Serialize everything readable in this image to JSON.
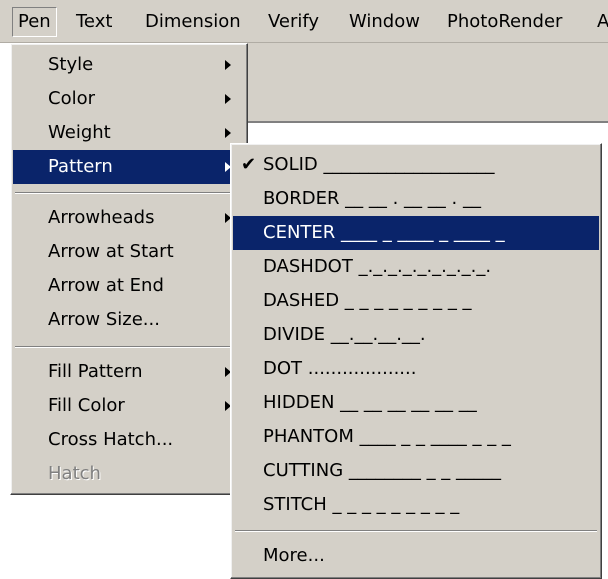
{
  "menubar": {
    "items": [
      "Pen",
      "Text",
      "Dimension",
      "Verify",
      "Window",
      "PhotoRender",
      "A"
    ]
  },
  "pen_menu": {
    "items": [
      {
        "label": "Style",
        "submenu": true
      },
      {
        "label": "Color",
        "submenu": true
      },
      {
        "label": "Weight",
        "submenu": true
      },
      {
        "label": "Pattern",
        "submenu": true,
        "highlighted": true
      },
      {
        "label": "Arrowheads",
        "submenu": true
      },
      {
        "label": "Arrow at Start"
      },
      {
        "label": "Arrow at End"
      },
      {
        "label": "Arrow Size..."
      },
      {
        "label": "Fill Pattern",
        "submenu": true
      },
      {
        "label": "Fill Color",
        "submenu": true
      },
      {
        "label": "Cross Hatch..."
      },
      {
        "label": "Hatch",
        "disabled": true
      }
    ]
  },
  "pattern_menu": {
    "items": [
      {
        "label": "SOLID ___________________",
        "checked": true
      },
      {
        "label": "BORDER __ __ . __ __ . __"
      },
      {
        "label": "CENTER ____ _ ____ _ ____ _",
        "highlighted": true
      },
      {
        "label": "DASHDOT _._._._._._._._._."
      },
      {
        "label": "DASHED _ _ _ _ _ _ _ _ _"
      },
      {
        "label": "DIVIDE __.__.__.__."
      },
      {
        "label": "DOT ..................."
      },
      {
        "label": "HIDDEN __ __ __ __ __ __"
      },
      {
        "label": "PHANTOM ____ _ _ ____ _ _ _"
      },
      {
        "label": "CUTTING ________ _ _ _____"
      },
      {
        "label": "STITCH _ _ _ _ _ _ _ _ _"
      },
      {
        "label": "More..."
      }
    ],
    "check_glyph": "✔"
  }
}
